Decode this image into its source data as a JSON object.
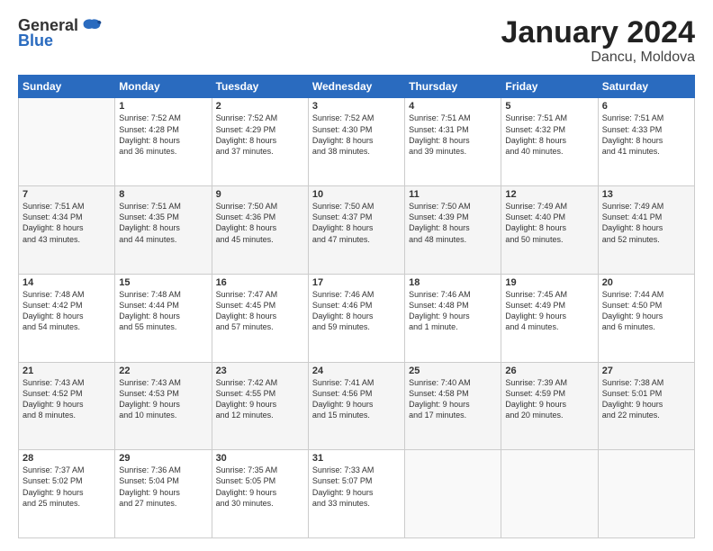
{
  "logo": {
    "general": "General",
    "blue": "Blue"
  },
  "title": "January 2024",
  "location": "Dancu, Moldova",
  "days_header": [
    "Sunday",
    "Monday",
    "Tuesday",
    "Wednesday",
    "Thursday",
    "Friday",
    "Saturday"
  ],
  "weeks": [
    [
      {
        "day": "",
        "info": ""
      },
      {
        "day": "1",
        "info": "Sunrise: 7:52 AM\nSunset: 4:28 PM\nDaylight: 8 hours\nand 36 minutes."
      },
      {
        "day": "2",
        "info": "Sunrise: 7:52 AM\nSunset: 4:29 PM\nDaylight: 8 hours\nand 37 minutes."
      },
      {
        "day": "3",
        "info": "Sunrise: 7:52 AM\nSunset: 4:30 PM\nDaylight: 8 hours\nand 38 minutes."
      },
      {
        "day": "4",
        "info": "Sunrise: 7:51 AM\nSunset: 4:31 PM\nDaylight: 8 hours\nand 39 minutes."
      },
      {
        "day": "5",
        "info": "Sunrise: 7:51 AM\nSunset: 4:32 PM\nDaylight: 8 hours\nand 40 minutes."
      },
      {
        "day": "6",
        "info": "Sunrise: 7:51 AM\nSunset: 4:33 PM\nDaylight: 8 hours\nand 41 minutes."
      }
    ],
    [
      {
        "day": "7",
        "info": "Sunrise: 7:51 AM\nSunset: 4:34 PM\nDaylight: 8 hours\nand 43 minutes."
      },
      {
        "day": "8",
        "info": "Sunrise: 7:51 AM\nSunset: 4:35 PM\nDaylight: 8 hours\nand 44 minutes."
      },
      {
        "day": "9",
        "info": "Sunrise: 7:50 AM\nSunset: 4:36 PM\nDaylight: 8 hours\nand 45 minutes."
      },
      {
        "day": "10",
        "info": "Sunrise: 7:50 AM\nSunset: 4:37 PM\nDaylight: 8 hours\nand 47 minutes."
      },
      {
        "day": "11",
        "info": "Sunrise: 7:50 AM\nSunset: 4:39 PM\nDaylight: 8 hours\nand 48 minutes."
      },
      {
        "day": "12",
        "info": "Sunrise: 7:49 AM\nSunset: 4:40 PM\nDaylight: 8 hours\nand 50 minutes."
      },
      {
        "day": "13",
        "info": "Sunrise: 7:49 AM\nSunset: 4:41 PM\nDaylight: 8 hours\nand 52 minutes."
      }
    ],
    [
      {
        "day": "14",
        "info": "Sunrise: 7:48 AM\nSunset: 4:42 PM\nDaylight: 8 hours\nand 54 minutes."
      },
      {
        "day": "15",
        "info": "Sunrise: 7:48 AM\nSunset: 4:44 PM\nDaylight: 8 hours\nand 55 minutes."
      },
      {
        "day": "16",
        "info": "Sunrise: 7:47 AM\nSunset: 4:45 PM\nDaylight: 8 hours\nand 57 minutes."
      },
      {
        "day": "17",
        "info": "Sunrise: 7:46 AM\nSunset: 4:46 PM\nDaylight: 8 hours\nand 59 minutes."
      },
      {
        "day": "18",
        "info": "Sunrise: 7:46 AM\nSunset: 4:48 PM\nDaylight: 9 hours\nand 1 minute."
      },
      {
        "day": "19",
        "info": "Sunrise: 7:45 AM\nSunset: 4:49 PM\nDaylight: 9 hours\nand 4 minutes."
      },
      {
        "day": "20",
        "info": "Sunrise: 7:44 AM\nSunset: 4:50 PM\nDaylight: 9 hours\nand 6 minutes."
      }
    ],
    [
      {
        "day": "21",
        "info": "Sunrise: 7:43 AM\nSunset: 4:52 PM\nDaylight: 9 hours\nand 8 minutes."
      },
      {
        "day": "22",
        "info": "Sunrise: 7:43 AM\nSunset: 4:53 PM\nDaylight: 9 hours\nand 10 minutes."
      },
      {
        "day": "23",
        "info": "Sunrise: 7:42 AM\nSunset: 4:55 PM\nDaylight: 9 hours\nand 12 minutes."
      },
      {
        "day": "24",
        "info": "Sunrise: 7:41 AM\nSunset: 4:56 PM\nDaylight: 9 hours\nand 15 minutes."
      },
      {
        "day": "25",
        "info": "Sunrise: 7:40 AM\nSunset: 4:58 PM\nDaylight: 9 hours\nand 17 minutes."
      },
      {
        "day": "26",
        "info": "Sunrise: 7:39 AM\nSunset: 4:59 PM\nDaylight: 9 hours\nand 20 minutes."
      },
      {
        "day": "27",
        "info": "Sunrise: 7:38 AM\nSunset: 5:01 PM\nDaylight: 9 hours\nand 22 minutes."
      }
    ],
    [
      {
        "day": "28",
        "info": "Sunrise: 7:37 AM\nSunset: 5:02 PM\nDaylight: 9 hours\nand 25 minutes."
      },
      {
        "day": "29",
        "info": "Sunrise: 7:36 AM\nSunset: 5:04 PM\nDaylight: 9 hours\nand 27 minutes."
      },
      {
        "day": "30",
        "info": "Sunrise: 7:35 AM\nSunset: 5:05 PM\nDaylight: 9 hours\nand 30 minutes."
      },
      {
        "day": "31",
        "info": "Sunrise: 7:33 AM\nSunset: 5:07 PM\nDaylight: 9 hours\nand 33 minutes."
      },
      {
        "day": "",
        "info": ""
      },
      {
        "day": "",
        "info": ""
      },
      {
        "day": "",
        "info": ""
      }
    ]
  ]
}
